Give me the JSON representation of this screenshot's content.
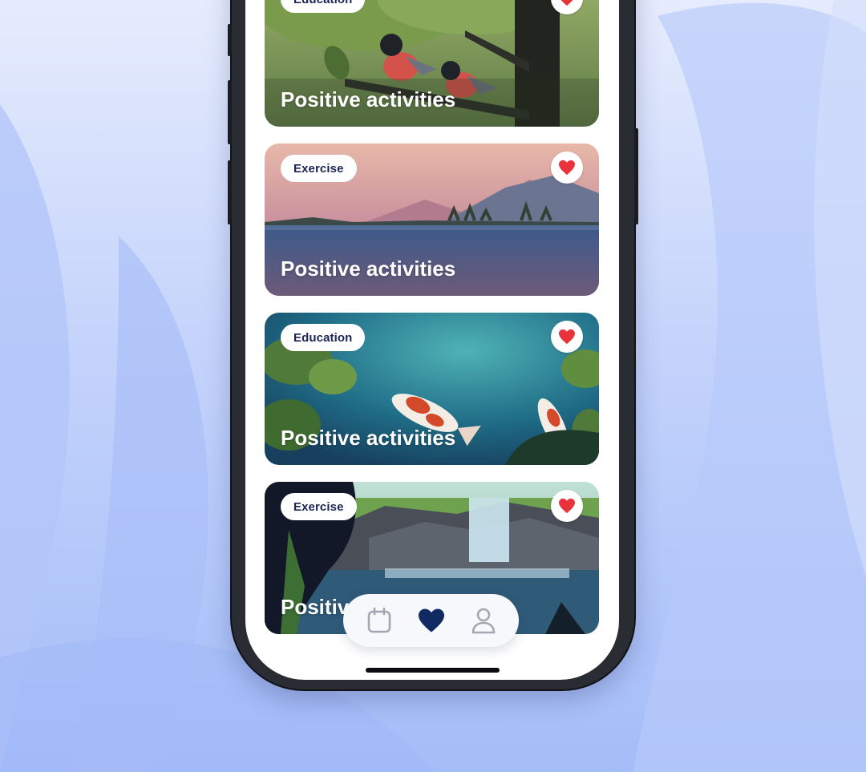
{
  "activities": [
    {
      "category": "Education",
      "title": "Positive activities",
      "favorited": true,
      "scene": "birds-tree"
    },
    {
      "category": "Exercise",
      "title": "Positive activities",
      "favorited": true,
      "scene": "lake-mountains"
    },
    {
      "category": "Education",
      "title": "Positive activities",
      "favorited": true,
      "scene": "koi-pond"
    },
    {
      "category": "Exercise",
      "title": "Positive activities",
      "favorited": true,
      "scene": "waterfall"
    }
  ],
  "nav": {
    "items": [
      {
        "icon": "calendar-icon",
        "active": false
      },
      {
        "icon": "heart-icon",
        "active": true
      },
      {
        "icon": "profile-icon",
        "active": false
      }
    ]
  },
  "colors": {
    "accent": "#112a63",
    "heart": "#e8323c",
    "tag_text": "#1c2455",
    "background": "#a4bdf8"
  }
}
